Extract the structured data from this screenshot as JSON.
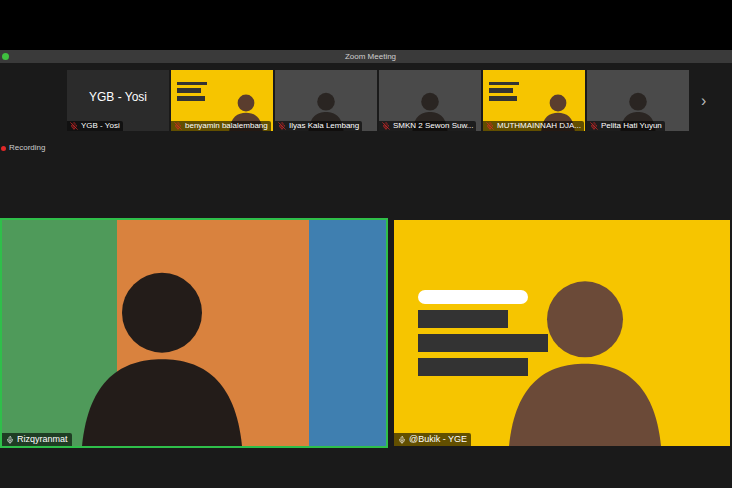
{
  "window": {
    "title": "Zoom Meeting"
  },
  "recording": {
    "label": "Recording",
    "on": true
  },
  "thumbnails": [
    {
      "name": "YGB - Yosi",
      "kind": "name",
      "muted": true
    },
    {
      "name": "benyamin balalembang",
      "kind": "slide",
      "muted": true
    },
    {
      "name": "Ilyas Kala Lembang",
      "kind": "camera",
      "muted": true
    },
    {
      "name": "SMKN 2 Sewon Suw...",
      "kind": "camera",
      "muted": true
    },
    {
      "name": "MUTHMAINNAH DJA...",
      "kind": "slide",
      "muted": true
    },
    {
      "name": "Pelita Hati Yuyun",
      "kind": "camera",
      "muted": true
    }
  ],
  "next_arrow": "›",
  "speakers": [
    {
      "name": "Rizqyranmat",
      "active": true,
      "muted": false,
      "kind": "room"
    },
    {
      "name": "@Bukik - YGE",
      "active": false,
      "muted": false,
      "kind": "slide"
    }
  ]
}
